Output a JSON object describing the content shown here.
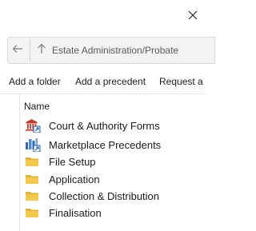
{
  "address": {
    "path": "Estate Administration/Probate"
  },
  "toolbar": {
    "add_folder": "Add a folder",
    "add_precedent": "Add a precedent",
    "request": "Request a f"
  },
  "list": {
    "column_header": "Name",
    "items": [
      {
        "label": "Court & Authority Forms",
        "icon": "court-shortcut-icon"
      },
      {
        "label": "Marketplace Precedents",
        "icon": "marketplace-shortcut-icon"
      },
      {
        "label": "File Setup",
        "icon": "folder-icon"
      },
      {
        "label": "Application",
        "icon": "folder-icon"
      },
      {
        "label": "Collection & Distribution",
        "icon": "folder-icon"
      },
      {
        "label": "Finalisation",
        "icon": "folder-icon"
      }
    ]
  },
  "colors": {
    "folder": "#f2c94c",
    "folder_dark": "#e3b232",
    "court_red": "#c0392b",
    "marketplace_blue": "#2f6db5",
    "shortcut_blue": "#1e5bb8"
  }
}
